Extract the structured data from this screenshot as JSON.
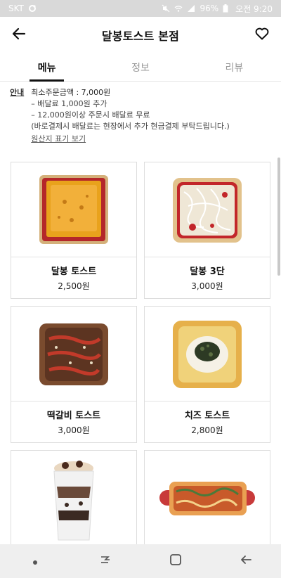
{
  "status_bar": {
    "carrier": "SKT",
    "battery": "96%",
    "time": "오전 9:20"
  },
  "app_bar": {
    "title": "달봉토스트 본점",
    "back_icon": "arrow-left-icon",
    "favorite_icon": "heart-outline-icon"
  },
  "tabs": [
    {
      "label": "메뉴",
      "active": true
    },
    {
      "label": "정보",
      "active": false
    },
    {
      "label": "리뷰",
      "active": false
    }
  ],
  "notice": {
    "tag": "안내",
    "min_order": "최소주문금액 : 7,000원",
    "lines": [
      "– 배달료 1,000원 추가",
      "– 12,000원이상 주문시 배달료 무료",
      "(바로결제시 배달료는 현장에서 추가 현금결제 부탁드립니다.)"
    ],
    "origin_link": "원산지 표기 보기"
  },
  "menu": [
    {
      "name": "달봉 토스트",
      "price": "2,500원"
    },
    {
      "name": "달봉 3단",
      "price": "3,000원"
    },
    {
      "name": "떡갈비 토스트",
      "price": "3,000원"
    },
    {
      "name": "치즈 토스트",
      "price": "2,800원"
    }
  ],
  "nav_bar": {
    "icons": [
      "dot-icon",
      "recent-apps-icon",
      "home-icon",
      "back-icon"
    ]
  }
}
